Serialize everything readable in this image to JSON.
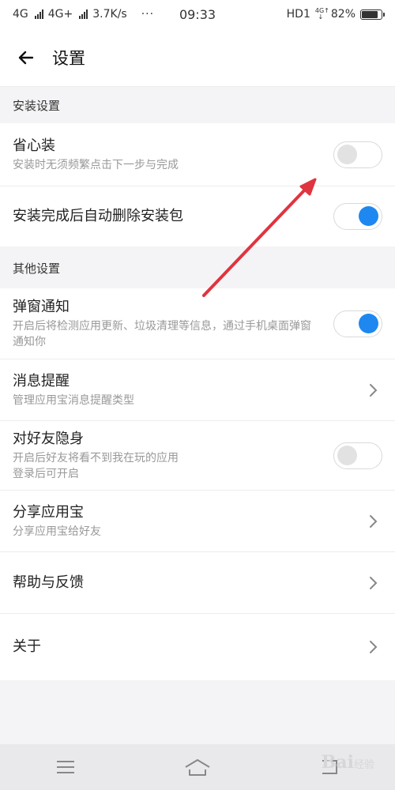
{
  "status_bar": {
    "carrier1": "4G",
    "carrier2": "4G+",
    "speed": "3.7K/s",
    "dots": "···",
    "time": "09:33",
    "hd": "HD1",
    "net_top": "4G↑",
    "net_bottom": "↓",
    "battery": "82%",
    "battery_level": 0.82
  },
  "header": {
    "back_icon": "arrow-left-icon",
    "title": "设置"
  },
  "sections": {
    "install": {
      "title": "安装设置",
      "items": [
        {
          "title": "省心装",
          "subtitle": "安装时无须频繁点击下一步与完成",
          "control": "toggle",
          "on": false
        },
        {
          "title": "安装完成后自动删除安装包",
          "control": "toggle",
          "on": true
        }
      ]
    },
    "other": {
      "title": "其他设置",
      "items": [
        {
          "title": "弹窗通知",
          "subtitle": "开启后将检测应用更新、垃圾清理等信息，通过手机桌面弹窗通知你",
          "control": "toggle",
          "on": true
        },
        {
          "title": "消息提醒",
          "subtitle": "管理应用宝消息提醒类型",
          "control": "chevron"
        },
        {
          "title": "对好友隐身",
          "subtitle": "开启后好友将看不到我在玩的应用",
          "subtitle2": "登录后可开启",
          "control": "toggle",
          "on": false
        },
        {
          "title": "分享应用宝",
          "subtitle": "分享应用宝给好友",
          "control": "chevron"
        },
        {
          "title": "帮助与反馈",
          "control": "chevron"
        },
        {
          "title": "关于",
          "control": "chevron"
        }
      ]
    }
  },
  "nav": {
    "menu_icon": "menu-icon",
    "home_icon": "home-icon",
    "back_icon": "back-icon"
  },
  "watermark": {
    "text": "Bai",
    "sub": "经验"
  },
  "colors": {
    "accent": "#1e88f0",
    "annotation_arrow": "#e0343f"
  }
}
